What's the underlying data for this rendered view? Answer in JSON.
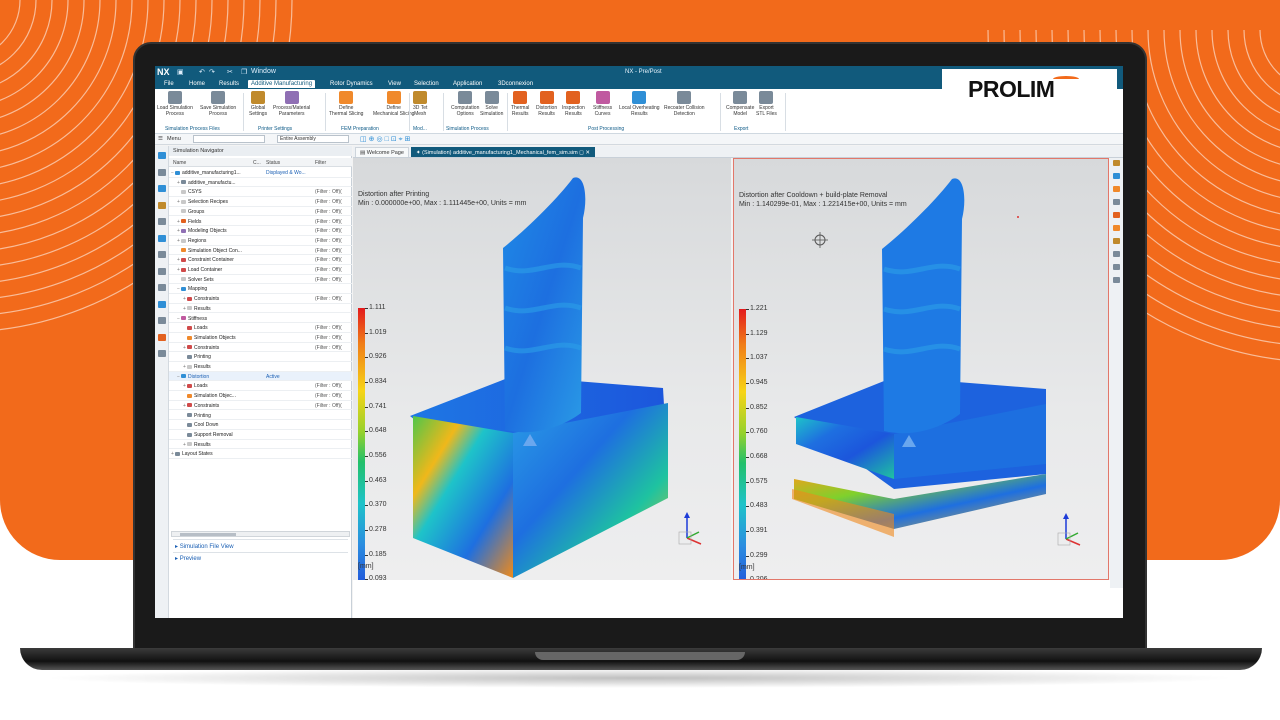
{
  "window": {
    "app": "NX",
    "title": "NX - Pre/Post",
    "window_menu": "Window",
    "brand": "PROLIM"
  },
  "menus": [
    "File",
    "Home",
    "Results",
    "Additive Manufacturing",
    "Rotor Dynamics",
    "View",
    "Selection",
    "Application",
    "3Dconnexion"
  ],
  "ribbon": {
    "buttons": [
      {
        "label1": "Load Simulation",
        "label2": "Process",
        "icon": "load-process-icon",
        "color": "#7a8a99"
      },
      {
        "label1": "Save Simulation",
        "label2": "Process",
        "icon": "save-process-icon",
        "color": "#7a8a99"
      },
      {
        "label1": "Global",
        "label2": "Settings",
        "icon": "global-settings-icon",
        "color": "#c08a2c"
      },
      {
        "label1": "Process/Material",
        "label2": "Parameters",
        "icon": "parameters-icon",
        "color": "#8f6fb4"
      },
      {
        "label1": "Define",
        "label2": "Thermal Slicing",
        "icon": "thermal-slicing-icon",
        "color": "#f0892b"
      },
      {
        "label1": "Define",
        "label2": "Mechanical Slicing",
        "icon": "mechanical-slicing-icon",
        "color": "#f0892b"
      },
      {
        "label1": "3D Tet",
        "label2": "Mesh",
        "icon": "tet-mesh-icon",
        "color": "#c08a2c"
      },
      {
        "label1": "Computation",
        "label2": "Options",
        "icon": "computation-icon",
        "color": "#7a8a99"
      },
      {
        "label1": "Solve",
        "label2": "Simulation",
        "icon": "solve-icon",
        "color": "#7a8a99"
      },
      {
        "label1": "Thermal",
        "label2": "Results",
        "icon": "thermal-results-icon",
        "color": "#e2611f"
      },
      {
        "label1": "Distortion",
        "label2": "Results",
        "icon": "distortion-results-icon",
        "color": "#e2611f"
      },
      {
        "label1": "Inspection",
        "label2": "Results",
        "icon": "inspection-results-icon",
        "color": "#e2611f"
      },
      {
        "label1": "Stiffness",
        "label2": "Curves",
        "icon": "stiffness-curves-icon",
        "color": "#c05aa0"
      },
      {
        "label1": "Local Overheating",
        "label2": "Results",
        "icon": "overheating-icon",
        "color": "#2f8fd6"
      },
      {
        "label1": "Recoater Collision",
        "label2": "Detection",
        "icon": "collision-icon",
        "color": "#7a8a99"
      },
      {
        "label1": "Compensate",
        "label2": "Model",
        "icon": "compensate-icon",
        "color": "#7a8a99"
      },
      {
        "label1": "Export",
        "label2": "STL Files",
        "icon": "export-stl-icon",
        "color": "#7a8a99"
      }
    ],
    "groups": [
      "Simulation Process Files",
      "Printer Settings",
      "FEM Preparation",
      "Mod...",
      "Simulation Process",
      "Post Processing",
      "Export"
    ]
  },
  "toolbar": {
    "menu_label": "Menu",
    "filter_value": "",
    "assembly_value": "Entire Assembly"
  },
  "navigator": {
    "title": "Simulation Navigator",
    "columns": [
      "Name",
      "C...",
      "Status",
      "Filter"
    ],
    "rows": [
      {
        "name": "additive_manufacturing1...",
        "status": "Displayed & Wo...",
        "filter": "",
        "indent": 0,
        "toggle": "−",
        "icon": "#2f8fd6"
      },
      {
        "name": "additive_manufactu...",
        "status": "",
        "filter": "",
        "indent": 1,
        "toggle": "+",
        "icon": "#7a8a99"
      },
      {
        "name": "CSYS",
        "status": "",
        "filter": "(Filter : Off)(",
        "indent": 1,
        "toggle": "",
        "icon": "#c8c8c8"
      },
      {
        "name": "Selection Recipes",
        "status": "",
        "filter": "(Filter : Off)(",
        "indent": 1,
        "toggle": "+",
        "icon": "#c8c8c8"
      },
      {
        "name": "Groups",
        "status": "",
        "filter": "(Filter : Off)(",
        "indent": 1,
        "toggle": "",
        "icon": "#c8c8c8"
      },
      {
        "name": "Fields",
        "status": "",
        "filter": "(Filter : Off)(",
        "indent": 1,
        "toggle": "+",
        "icon": "#e2611f"
      },
      {
        "name": "Modeling Objects",
        "status": "",
        "filter": "(Filter : Off)(",
        "indent": 1,
        "toggle": "+",
        "icon": "#8f6fb4"
      },
      {
        "name": "Regions",
        "status": "",
        "filter": "(Filter : Off)(",
        "indent": 1,
        "toggle": "+",
        "icon": "#c8c8c8"
      },
      {
        "name": "Simulation Object Con...",
        "status": "",
        "filter": "(Filter : Off)(",
        "indent": 1,
        "toggle": "",
        "icon": "#f0892b"
      },
      {
        "name": "Constraint Container",
        "status": "",
        "filter": "(Filter : Off)(",
        "indent": 1,
        "toggle": "+",
        "icon": "#d04a4a"
      },
      {
        "name": "Load Container",
        "status": "",
        "filter": "(Filter : Off)(",
        "indent": 1,
        "toggle": "+",
        "icon": "#d04a4a"
      },
      {
        "name": "Solver Sets",
        "status": "",
        "filter": "(Filter : Off)(",
        "indent": 1,
        "toggle": "",
        "icon": "#c8c8c8"
      },
      {
        "name": "Mapping",
        "status": "",
        "filter": "",
        "indent": 1,
        "toggle": "−",
        "icon": "#2f8fd6"
      },
      {
        "name": "Constraints",
        "status": "",
        "filter": "(Filter : Off)(",
        "indent": 2,
        "toggle": "+",
        "icon": "#d04a4a"
      },
      {
        "name": "Results",
        "status": "",
        "filter": "",
        "indent": 2,
        "toggle": "+",
        "icon": "#c8c8c8"
      },
      {
        "name": "Stiffness",
        "status": "",
        "filter": "",
        "indent": 1,
        "toggle": "−",
        "icon": "#c05aa0"
      },
      {
        "name": "Loads",
        "status": "",
        "filter": "(Filter : Off)(",
        "indent": 2,
        "toggle": "",
        "icon": "#d04a4a"
      },
      {
        "name": "Simulation Objects",
        "status": "",
        "filter": "(Filter : Off)(",
        "indent": 2,
        "toggle": "",
        "icon": "#f0892b"
      },
      {
        "name": "Constraints",
        "status": "",
        "filter": "(Filter : Off)(",
        "indent": 2,
        "toggle": "+",
        "icon": "#d04a4a"
      },
      {
        "name": "Printing",
        "status": "",
        "filter": "",
        "indent": 2,
        "toggle": "",
        "icon": "#7a8a99"
      },
      {
        "name": "Results",
        "status": "",
        "filter": "",
        "indent": 2,
        "toggle": "+",
        "icon": "#c8c8c8"
      },
      {
        "name": "Distortion",
        "status": "Active",
        "filter": "",
        "indent": 1,
        "toggle": "−",
        "icon": "#2f8fd6",
        "highlight": true
      },
      {
        "name": "Loads",
        "status": "",
        "filter": "(Filter : Off)(",
        "indent": 2,
        "toggle": "+",
        "icon": "#d04a4a"
      },
      {
        "name": "Simulation Objec...",
        "status": "",
        "filter": "(Filter : Off)(",
        "indent": 2,
        "toggle": "",
        "icon": "#f0892b"
      },
      {
        "name": "Constraints",
        "status": "",
        "filter": "(Filter : Off)(",
        "indent": 2,
        "toggle": "+",
        "icon": "#d04a4a"
      },
      {
        "name": "Printing",
        "status": "",
        "filter": "",
        "indent": 2,
        "toggle": "",
        "icon": "#7a8a99"
      },
      {
        "name": "Cool Down",
        "status": "",
        "filter": "",
        "indent": 2,
        "toggle": "",
        "icon": "#7a8a99"
      },
      {
        "name": "Support Removal",
        "status": "",
        "filter": "",
        "indent": 2,
        "toggle": "",
        "icon": "#7a8a99"
      },
      {
        "name": "Results",
        "status": "",
        "filter": "",
        "indent": 2,
        "toggle": "+",
        "icon": "#c8c8c8"
      },
      {
        "name": "Layout States",
        "status": "",
        "filter": "",
        "indent": 0,
        "toggle": "+",
        "icon": "#7a8a99"
      }
    ],
    "links": [
      "Simulation File View",
      "Preview"
    ]
  },
  "tabs": [
    "Welcome Page",
    "(Simulation) additive_manufacturing1_Mechanical_fem_sim.sim"
  ],
  "viewports": [
    {
      "title": "Distortion after Printing",
      "subtitle": "Min : 0.000000e+00, Max : 1.111445e+00, Units = mm",
      "ticks": [
        "1.111",
        "1.019",
        "0.926",
        "0.834",
        "0.741",
        "0.648",
        "0.556",
        "0.463",
        "0.370",
        "0.278",
        "0.185",
        "0.093",
        "0.000"
      ],
      "unit": "[mm]"
    },
    {
      "title": "Distortion after Cooldown + build-plate Removal",
      "subtitle": "Min : 1.140299e-01, Max : 1.221415e+00, Units = mm",
      "ticks": [
        "1.221",
        "1.129",
        "1.037",
        "0.945",
        "0.852",
        "0.760",
        "0.668",
        "0.575",
        "0.483",
        "0.391",
        "0.299",
        "0.206",
        "0.114"
      ],
      "unit": "[mm]"
    }
  ],
  "colors": {
    "brand_orange": "#f26a1b",
    "nx_blue": "#115a7c",
    "link_blue": "#1a5fb4"
  }
}
